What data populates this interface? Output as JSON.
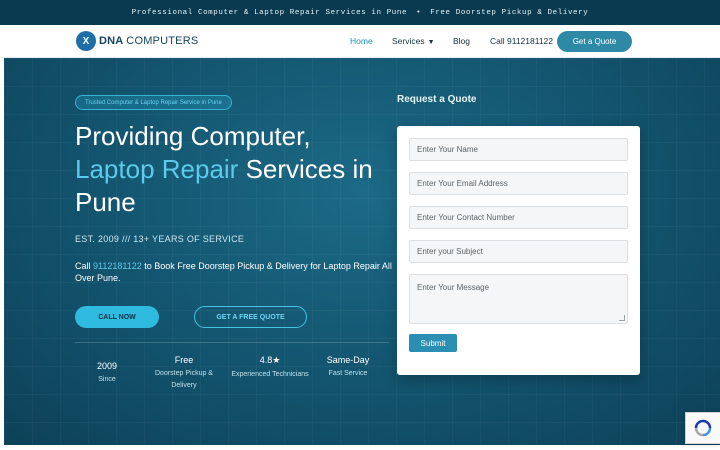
{
  "topbar": {
    "left": "Professional Computer & Laptop Repair Services in Pune",
    "separator": "•",
    "right": "Free Doorstep Pickup & Delivery"
  },
  "logo": {
    "mark": "X",
    "name_bold": "DNA",
    "name_light": "COMPUTERS"
  },
  "nav": {
    "home": "Home",
    "services": "Services",
    "blog": "Blog",
    "call": "Call 9112181122",
    "quote_button": "Get a Quote"
  },
  "hero": {
    "badge": "Trusted Computer & Laptop Repair Service in Pune",
    "title_line1": "Providing Computer,",
    "title_highlight": "Laptop Repair",
    "title_rest": " Services in",
    "title_line3": "Pune",
    "est": "EST. 2009 /// 13+ YEARS OF SERVICE",
    "call_prefix": "Call ",
    "call_phone": "9112181122",
    "call_suffix": " to Book Free Doorstep Pickup & Delivery for Laptop Repair All Over Pune.",
    "btn_call": "CALL NOW",
    "btn_quote": "GET A FREE QUOTE",
    "stats": [
      {
        "value": "2009",
        "label": "Since"
      },
      {
        "value": "Free",
        "label": "Doorstep Pickup & Delivery"
      },
      {
        "value": "4.8★",
        "label": "Experienced Technicians"
      },
      {
        "value": "Same-Day",
        "label": "Fast Service"
      }
    ]
  },
  "form": {
    "title": "Request a Quote",
    "name_placeholder": "Enter Your Name",
    "email_placeholder": "Enter Your Email Address",
    "contact_placeholder": "Enter Your Contact Number",
    "subject_placeholder": "Enter your Subject",
    "message_placeholder": "Enter Your Message",
    "submit": "Submit"
  },
  "icons": {
    "caret": "chevron-down-icon",
    "recaptcha": "recaptcha-icon"
  },
  "colors": {
    "primary": "#145772",
    "accent": "#5ccaea",
    "button": "#2e89a6"
  }
}
